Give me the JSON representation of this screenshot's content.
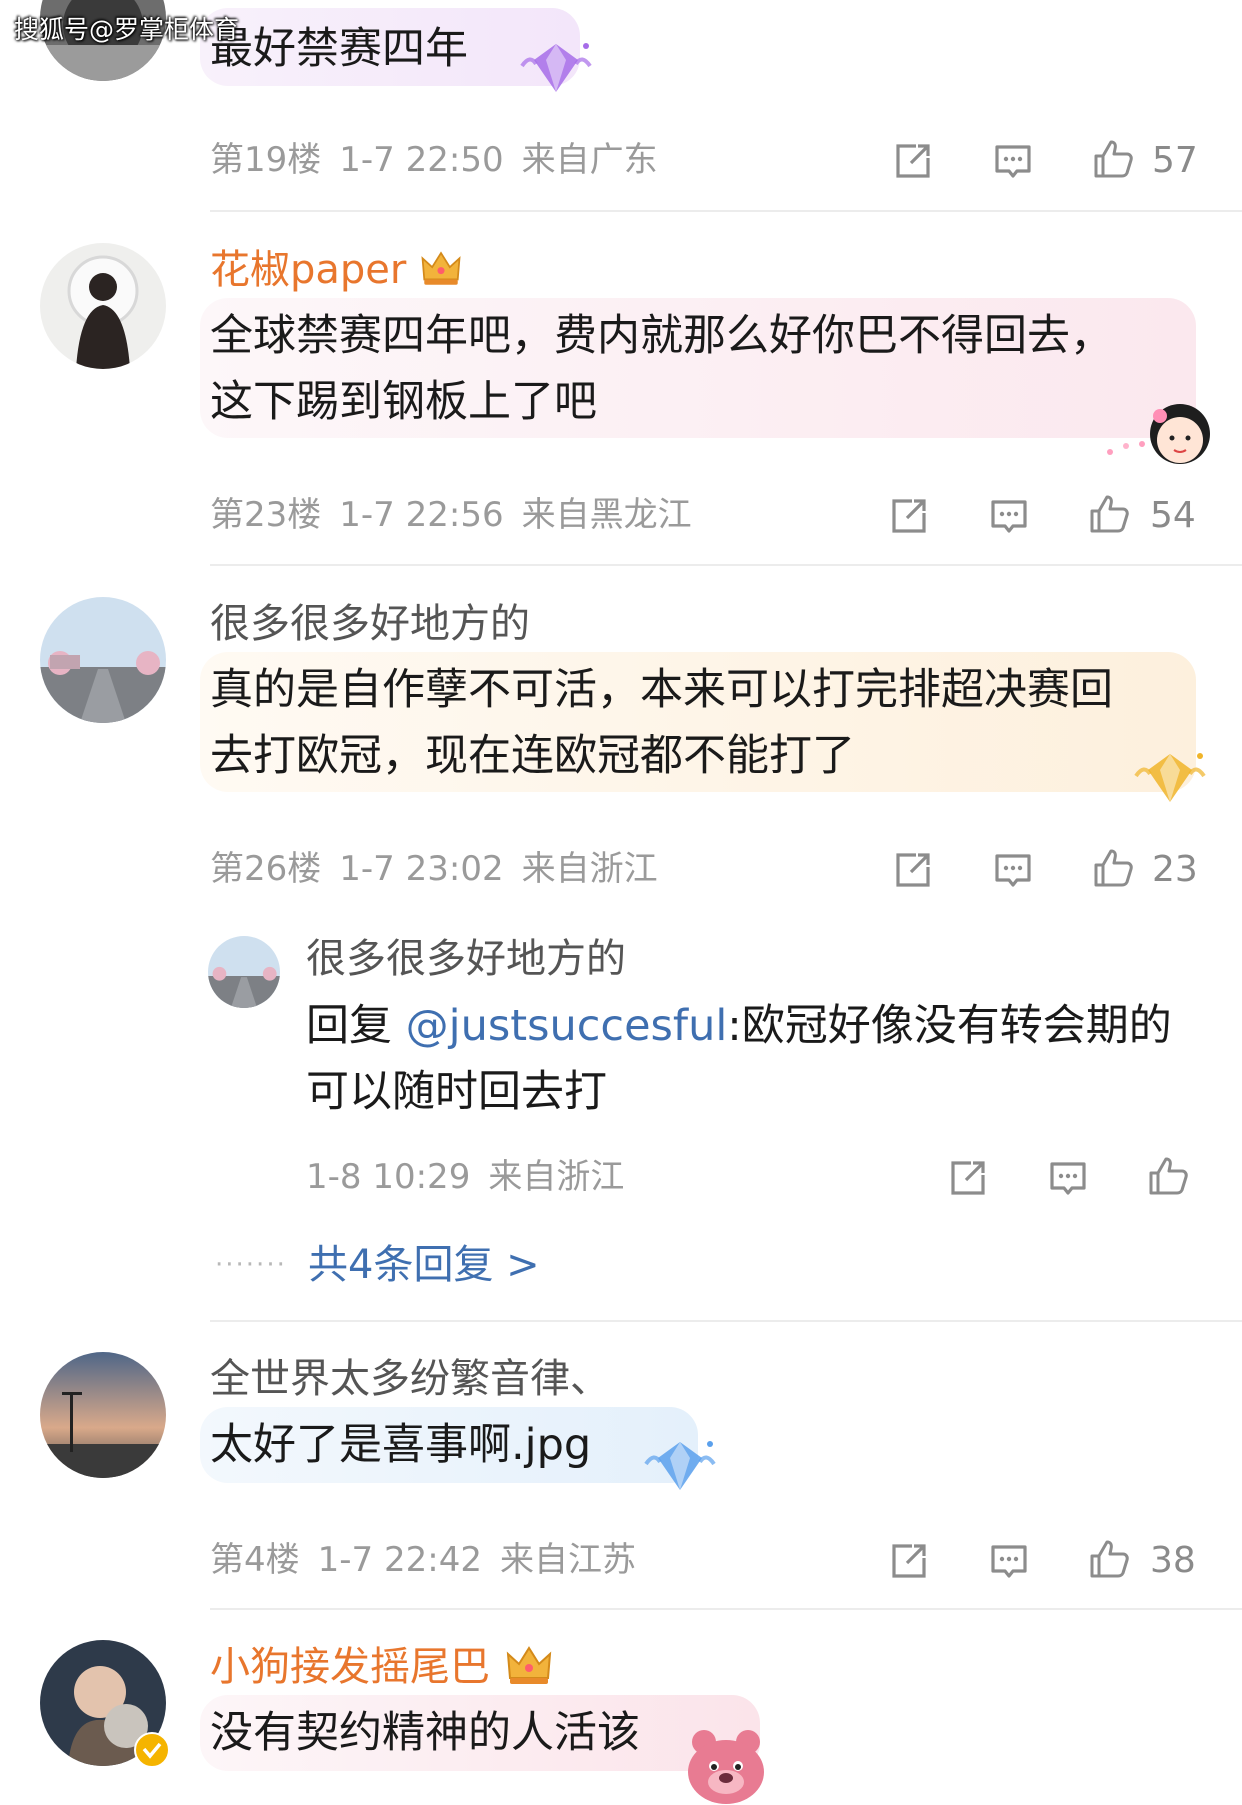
{
  "watermark": "搜狐号@罗掌柜体育",
  "colors": {
    "vip_name": "#e8762d",
    "link": "#3f6fb0",
    "meta": "#9a9a9a"
  },
  "comments": [
    {
      "content_lines": [
        "最好禁赛四年"
      ],
      "floor": "第19楼",
      "time": "1-7 22:50",
      "location": "来自广东",
      "likes": "57",
      "sticker": "purple-gem-icon"
    },
    {
      "username": "花椒paper",
      "badge": "crown-icon",
      "content_lines": [
        "全球禁赛四年吧，费内就那么好你巴不得回去，",
        "这下踢到钢板上了吧"
      ],
      "floor": "第23楼",
      "time": "1-7 22:56",
      "location": "来自黑龙江",
      "likes": "54",
      "sticker": "cartoon-girl-icon"
    },
    {
      "username": "很多很多好地方的",
      "content_lines": [
        "真的是自作孽不可活，本来可以打完排超决赛回",
        "去打欧冠，现在连欧冠都不能打了"
      ],
      "floor": "第26楼",
      "time": "1-7 23:02",
      "location": "来自浙江",
      "likes": "23",
      "sticker": "gold-gem-icon",
      "reply": {
        "username": "很多很多好地方的",
        "prefix": "回复 ",
        "mention": "@justsuccesful",
        "line1_rest": ":欧冠好像没有转会期的",
        "line2": "可以随时回去打",
        "time": "1-8 10:29",
        "location": "来自浙江"
      },
      "more_replies": "共4条回复 >"
    },
    {
      "username": "全世界太多纷繁音律、",
      "content_lines": [
        "太好了是喜事啊.jpg"
      ],
      "floor": "第4楼",
      "time": "1-7 22:42",
      "location": "来自江苏",
      "likes": "38",
      "sticker": "blue-gem-icon"
    },
    {
      "username": "小狗接发摇尾巴",
      "badge": "crown-icon",
      "content_lines": [
        "没有契约精神的人活该"
      ],
      "sticker": "pink-bear-icon"
    }
  ]
}
